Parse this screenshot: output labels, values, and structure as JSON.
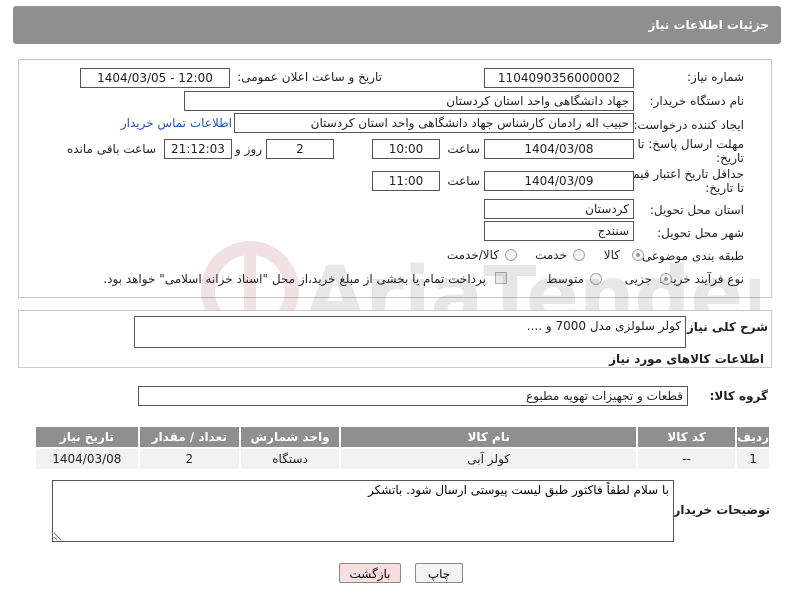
{
  "header": {
    "title": "جزئیات اطلاعات نیاز"
  },
  "form": {
    "need_number_label": "شماره نیاز:",
    "need_number": "1104090356000002",
    "announce_label": "تاریخ و ساعت اعلان عمومی:",
    "announce_value": "1404/03/05 - 12:00",
    "buyer_org_label": "نام دستگاه خریدار:",
    "buyer_org": "جهاد دانشگاهی واحد استان کردستان",
    "creator_label": "ایجاد کننده درخواست:",
    "creator": "حبیب اله رادمان کارشناس جهاد دانشگاهی واحد استان کردستان",
    "contact_link": "اطلاعات تماس خریدار",
    "reply_deadline_label_1": "مهلت ارسال پاسخ: تا",
    "reply_deadline_label_2": "تاریخ:",
    "reply_date": "1404/03/08",
    "time_label": "ساعت",
    "reply_time": "10:00",
    "days_value": "2",
    "days_label": "روز و",
    "remaining_time": "21:12:03",
    "remaining_label": "ساعت باقی مانده",
    "price_validity_label_1": "حداقل تاریخ اعتبار قیمت:",
    "price_validity_label_2": "تا تاریخ:",
    "validity_date": "1404/03/09",
    "validity_time": "11:00",
    "province_label": "استان محل تحویل:",
    "province": "کردستان",
    "city_label": "شهر محل تحویل:",
    "city": "سنندج",
    "category_label": "طبقه بندی موضوعی:",
    "category_options": [
      "کالا",
      "خدمت",
      "کالا/خدمت"
    ],
    "purchase_type_label": "نوع فرآیند خرید :",
    "purchase_options": [
      "جزیی",
      "متوسط"
    ],
    "payment_note": "پرداخت تمام یا بخشی از مبلغ خرید،از محل \"اسناد خزانه اسلامی\" خواهد بود."
  },
  "summary": {
    "label": "شرح کلی نیاز:",
    "value": "کولر سلولزی مدل 7000 و ...."
  },
  "goods": {
    "section_title": "اطلاعات کالاهای مورد نیاز",
    "group_label": "گروه کالا:",
    "group_value": "قطعات و تجهیزات تهویه مطبوع",
    "columns": [
      "ردیف",
      "کد کالا",
      "نام کالا",
      "واحد شمارش",
      "تعداد / مقدار",
      "تاریخ نیاز"
    ],
    "rows": [
      {
        "row": "1",
        "code": "--",
        "name": "کولر آبی",
        "unit": "دستگاه",
        "qty": "2",
        "date": "1404/03/08"
      }
    ]
  },
  "buyer_notes": {
    "label": "توضیحات خریدار:",
    "value": "با سلام لطفاً فاکتور طبق لیست پیوستی ارسال شود. باتشکر"
  },
  "buttons": {
    "print": "چاپ",
    "back": "بازگشت"
  },
  "watermark_text": "AriaTender.neT",
  "colors": {
    "header_bg": "#8f8f8f",
    "link": "#1a56b0",
    "back_button_bg": "#f9dede"
  }
}
